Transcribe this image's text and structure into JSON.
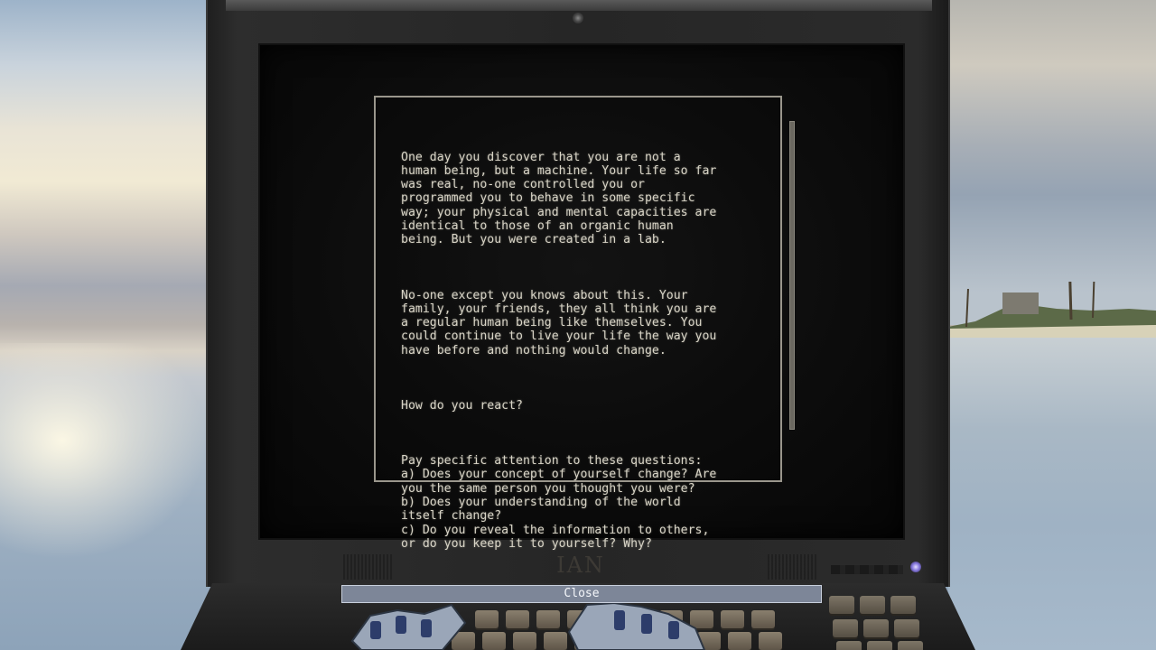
{
  "terminal": {
    "paragraphs": [
      "One day you discover that you are not a\nhuman being, but a machine. Your life so far\nwas real, no-one controlled you or\nprogrammed you to behave in some specific\nway; your physical and mental capacities are\nidentical to those of an organic human\nbeing. But you were created in a lab.",
      "No-one except you knows about this. Your\nfamily, your friends, they all think you are\na regular human being like themselves. You\ncould continue to live your life the way you\nhave before and nothing would change.",
      "How do you react?",
      "Pay specific attention to these questions:\na) Does your concept of yourself change? Are\nyou the same person you thought you were?\nb) Does your understanding of the world\nitself change?\nc) Do you reveal the information to others,\nor do you keep it to yourself? Why?"
    ]
  },
  "monitor": {
    "brand": "IAN"
  },
  "dialog": {
    "close_label": "Close"
  },
  "colors": {
    "terminal_text": "#d8d4c6",
    "panel_border": "#9a968c",
    "close_bar": "#8c96ac",
    "power_led": "#8a7ce0"
  },
  "icons": {
    "power_led": "power-led-icon",
    "webcam": "webcam-icon"
  }
}
